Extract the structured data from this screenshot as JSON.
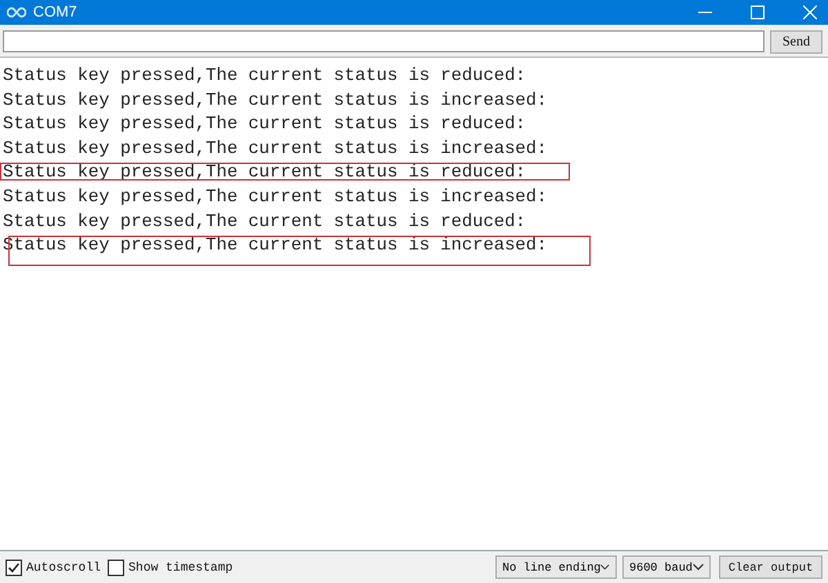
{
  "window": {
    "title": "COM7"
  },
  "input": {
    "button": "Send"
  },
  "output": {
    "lines": [
      {
        "text": "Status key pressed,The current status is reduced:",
        "highlighted": false
      },
      {
        "text": "Status key pressed,The current status is increased:",
        "highlighted": false
      },
      {
        "text": "Status key pressed,The current status is reduced:",
        "highlighted": false
      },
      {
        "text": "Status key pressed,The current status is increased:",
        "highlighted": false
      },
      {
        "text": "Status key pressed,The current status is reduced:",
        "highlighted": true,
        "tall": false
      },
      {
        "text": "Status key pressed,The current status is increased:",
        "highlighted": false
      },
      {
        "text": "Status key pressed,The current status is reduced:",
        "highlighted": false
      },
      {
        "text": "Status key pressed,The current status is increased:",
        "highlighted": true,
        "tall": true
      }
    ]
  },
  "footer": {
    "checkboxes": [
      {
        "label": "Autoscroll",
        "checked": true
      },
      {
        "label": "Show timestamp",
        "checked": false
      }
    ],
    "line_ending": "No line ending",
    "baud": "9600 baud",
    "clear": "Clear output"
  }
}
